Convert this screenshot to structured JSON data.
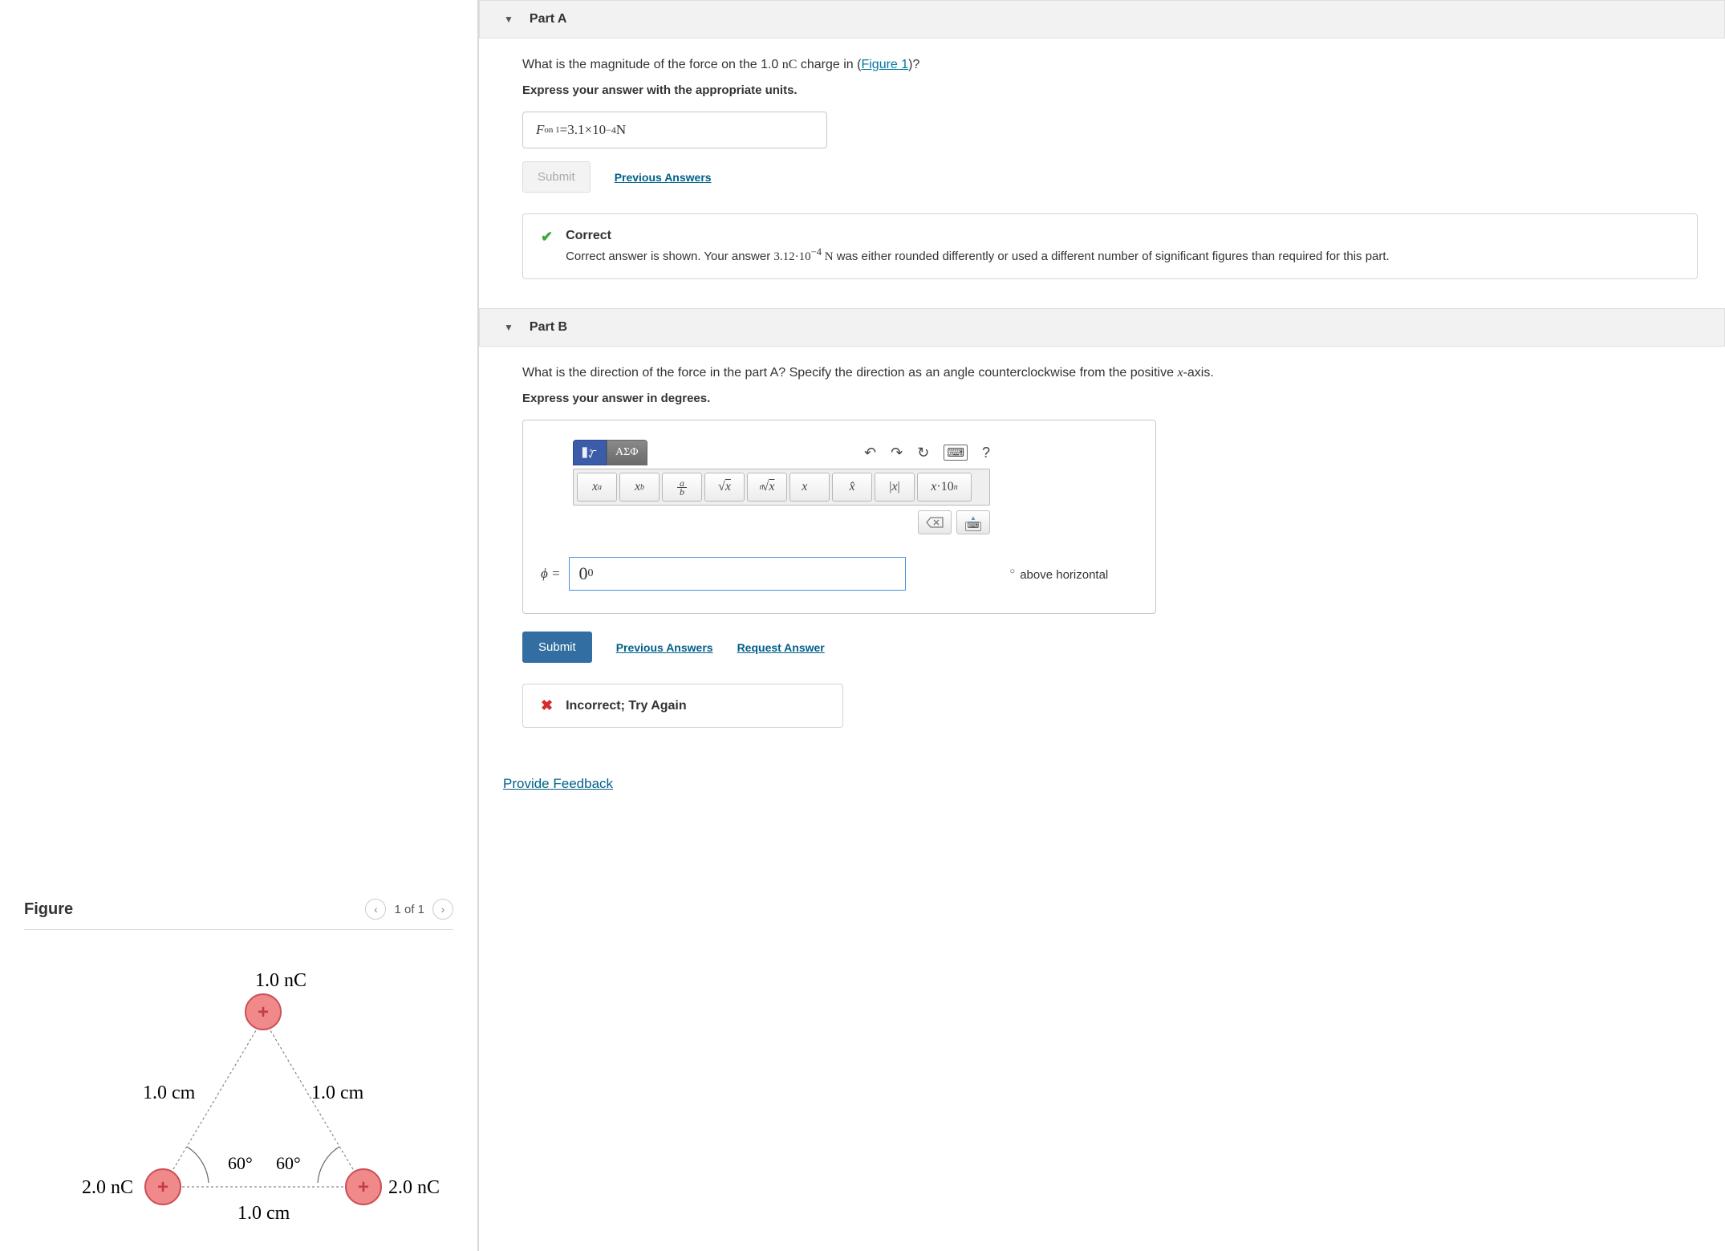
{
  "partA": {
    "title": "Part A",
    "question_prefix": "What is the magnitude of the force on the 1.0 ",
    "question_unit": "nC",
    "question_mid": " charge in (",
    "figure_link": "Figure 1",
    "question_end": ")?",
    "instruction": "Express your answer with the appropriate units.",
    "answer_var": "F",
    "answer_sub": "on 1",
    "answer_eq": " = ",
    "answer_val": "3.1×10",
    "answer_exp": "−4",
    "answer_unit": " N",
    "submit_label": "Submit",
    "prev_answers_label": "Previous Answers",
    "feedback_title": "Correct",
    "feedback_text_a": "Correct answer is shown. Your answer ",
    "feedback_val": "3.12·10",
    "feedback_exp": "−4",
    "feedback_unit": " N",
    "feedback_text_b": " was either rounded differently or used a different number of significant figures than required for this part."
  },
  "partB": {
    "title": "Part B",
    "question_prefix": "What is the direction of the force in the part A? Specify the direction as an angle counterclockwise from the positive ",
    "question_var": "x",
    "question_end": "-axis.",
    "instruction": "Express your answer in degrees.",
    "greek_tab": "ΑΣΦ",
    "toolbar2": {
      "b1": "x",
      "b1s": "a",
      "b2": "x",
      "b2s": "b",
      "b3top": "a",
      "b3bot": "b",
      "b4": "√x",
      "b5": "√x",
      "b5n": "n",
      "b6": "x⃗",
      "b7": "x̂",
      "b8": "|x|",
      "b9": "x·10",
      "b9s": "n"
    },
    "phi_label": "ϕ =",
    "input_value": "0",
    "input_exp": "0",
    "suffix_text": "above horizontal",
    "submit_label": "Submit",
    "prev_answers_label": "Previous Answers",
    "request_answer_label": "Request Answer",
    "feedback_title": "Incorrect; Try Again"
  },
  "provide_feedback": "Provide Feedback",
  "figure": {
    "title": "Figure",
    "pager_text": "1 of 1",
    "top_label": "1.0 nC",
    "left_label": "2.0 nC",
    "right_label": "2.0 nC",
    "side_left": "1.0 cm",
    "side_right": "1.0 cm",
    "base_label": "1.0 cm",
    "angle_left": "60°",
    "angle_right": "60°"
  }
}
